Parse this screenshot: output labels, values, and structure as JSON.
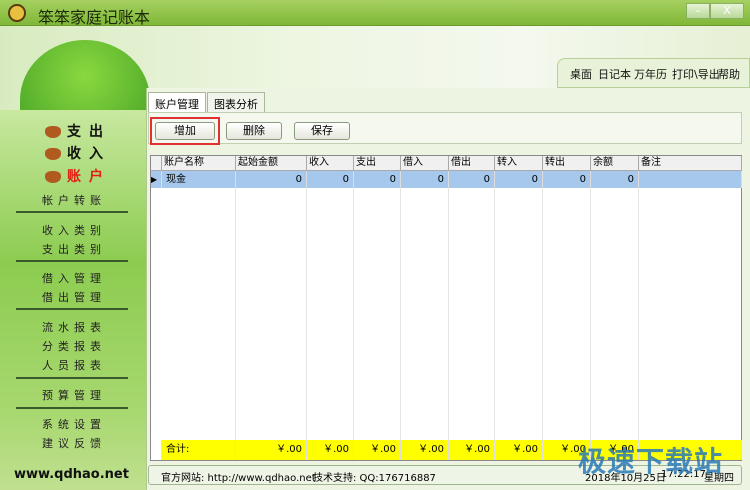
{
  "window": {
    "title": "笨笨家庭记账本",
    "minimize": "–",
    "close": "X"
  },
  "menu": [
    "桌面",
    "日记本",
    "万年历",
    "打印\\导出",
    "帮助"
  ],
  "sidebar": {
    "main": [
      {
        "label": "支出",
        "active": false
      },
      {
        "label": "收入",
        "active": false
      },
      {
        "label": "账户",
        "active": true
      }
    ],
    "groups": [
      [
        "帐户转账"
      ],
      [
        "收入类别",
        "支出类别"
      ],
      [
        "借入管理",
        "借出管理"
      ],
      [
        "流水报表",
        "分类报表",
        "人员报表"
      ],
      [
        "预算管理"
      ],
      [
        "系统设置",
        "建议反馈"
      ]
    ],
    "site": "www.qdhao.net"
  },
  "tabs": [
    {
      "label": "账户管理",
      "active": true
    },
    {
      "label": "图表分析",
      "active": false
    }
  ],
  "toolbar": {
    "add": "增加",
    "delete": "删除",
    "save": "保存"
  },
  "table": {
    "columns": [
      "账户名称",
      "起始金额",
      "收入",
      "支出",
      "借入",
      "借出",
      "转入",
      "转出",
      "余额",
      "备注"
    ],
    "rows": [
      [
        "现金",
        "0",
        "0",
        "0",
        "0",
        "0",
        "0",
        "0",
        "0",
        ""
      ]
    ],
    "totals": [
      "合计:",
      "￥.00",
      "￥.00",
      "￥.00",
      "￥.00",
      "￥.00",
      "￥.00",
      "￥.00",
      "￥.00",
      ""
    ]
  },
  "status": {
    "website": "官方网站: http://www.qdhao.net",
    "support": "技术支持: QQ:176716887",
    "date": "2018年10月25日",
    "time": "17:22:17",
    "weekday": "星期四"
  },
  "watermark": "极速下载站",
  "colors": {
    "selected_row": "#a6c8ec",
    "totals_row": "#ffff00",
    "active_nav": "#e02010",
    "add_highlight": "#e03030"
  }
}
